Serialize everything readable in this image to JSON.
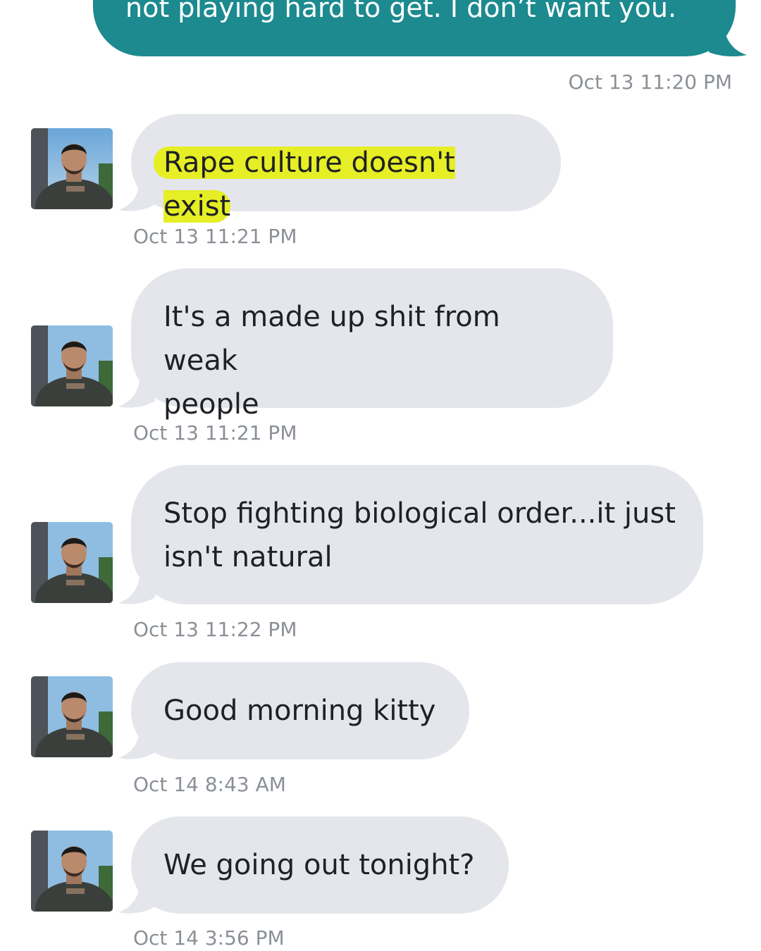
{
  "conversation": {
    "sent_message": {
      "text": "not playing hard to get. I don’t want you.",
      "timestamp": "Oct 13 11:20 PM"
    },
    "received_messages": [
      {
        "text": "Rape culture doesn't exist",
        "timestamp": "Oct 13 11:21 PM",
        "highlighted": true
      },
      {
        "line1": "It's a made up shit from weak",
        "line2": "people",
        "timestamp": "Oct 13 11:21 PM"
      },
      {
        "line1": "Stop fighting biological order...it just",
        "line2": "isn't natural",
        "timestamp": "Oct 13 11:22 PM"
      },
      {
        "text": "Good morning kitty",
        "timestamp": "Oct 14 8:43 AM"
      },
      {
        "text": "We going out tonight?",
        "timestamp": "Oct 14 3:56 PM"
      }
    ]
  },
  "colors": {
    "sent_bubble": "#1c8a8f",
    "received_bubble": "#e4e6ec",
    "highlight": "#e6ee25",
    "timestamp": "#8b9097"
  },
  "icons": {
    "avatar": "contact-avatar-photo"
  }
}
